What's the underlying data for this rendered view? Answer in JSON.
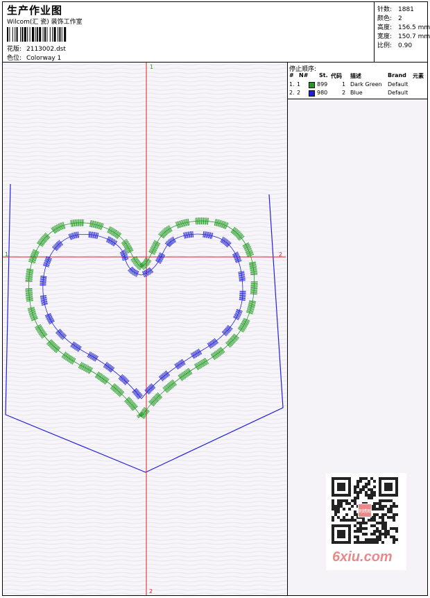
{
  "header": {
    "title": "生产作业图",
    "studio": "Wilcom(汇 瓷) 装饰工作室",
    "design_label": "花版:",
    "design_value": "2113002.dst",
    "colorway_label": "色位:",
    "colorway_value": "Colorway 1"
  },
  "stats": [
    {
      "label": "针数:",
      "value": "1881"
    },
    {
      "label": "颜色:",
      "value": "2"
    },
    {
      "label": "高度:",
      "value": "156.5 mm"
    },
    {
      "label": "宽度:",
      "value": "150.7 mm"
    },
    {
      "label": "比例:",
      "value": "0.90"
    }
  ],
  "stop_sequence": {
    "title": "停止顺序:",
    "columns": [
      "#",
      "N#",
      "St.",
      "代码",
      "描述",
      "Brand",
      "元素"
    ],
    "rows": [
      {
        "num": "1.",
        "n": "1",
        "color": "#1e9a1e",
        "st": "899",
        "code": "1",
        "desc": "Dark Green",
        "brand": "Default"
      },
      {
        "num": "2.",
        "n": "2",
        "color": "#1f1fe0",
        "st": "980",
        "code": "2",
        "desc": "Blue",
        "brand": "Default"
      }
    ]
  },
  "axes": {
    "top_label": "1",
    "left_label": "1",
    "right_label": "2",
    "bottom_label": "2"
  },
  "colors": {
    "thread_green": "#1e9a1e",
    "thread_blue": "#1f1fe0",
    "outline": "#1f1fe0",
    "axis": "#e01f1f"
  },
  "watermark": "6xiu.com",
  "qr_stamp": "刺绣图"
}
